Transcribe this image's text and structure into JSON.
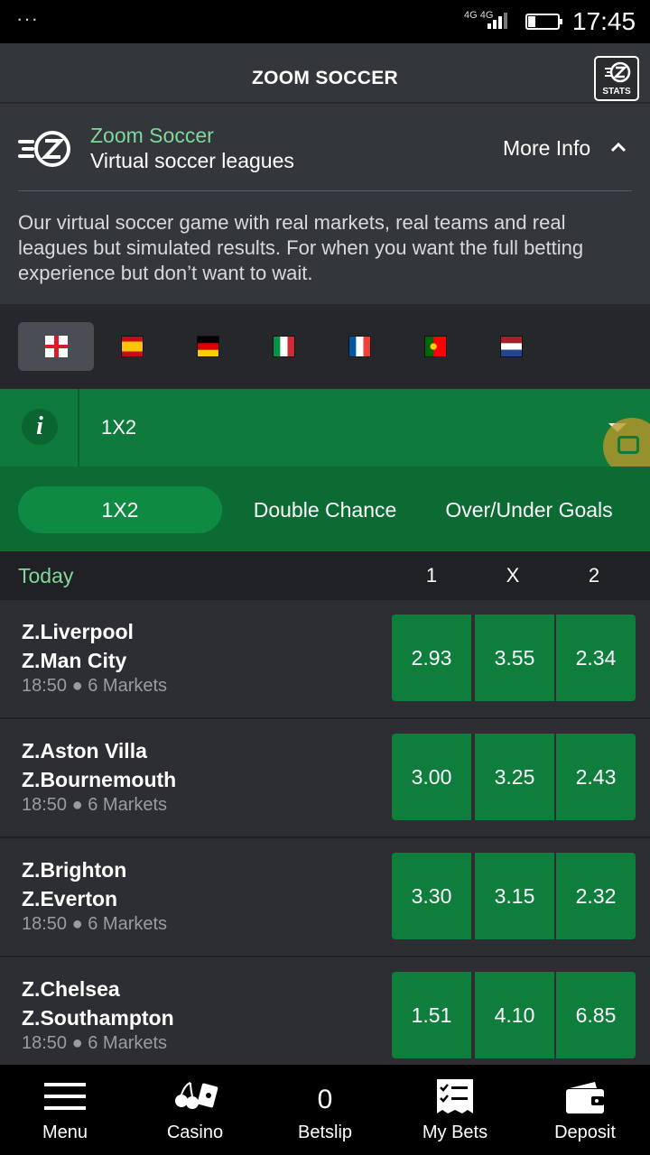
{
  "status_bar": {
    "dots": "···",
    "network": "4G 4G",
    "sim": "1",
    "time": "17:45"
  },
  "header": {
    "title": "ZOOM SOCCER",
    "stats_label": "STATS"
  },
  "info": {
    "name": "Zoom Soccer",
    "subtitle": "Virtual soccer leagues",
    "more_info": "More Info",
    "description": "Our virtual soccer game with real markets, real teams and real leagues but simulated results. For when you want the full betting experience but don’t want to wait."
  },
  "leagues": [
    {
      "country": "England",
      "active": true
    },
    {
      "country": "Spain",
      "active": false
    },
    {
      "country": "Germany",
      "active": false
    },
    {
      "country": "Italy",
      "active": false
    },
    {
      "country": "France",
      "active": false
    },
    {
      "country": "Portugal",
      "active": false
    },
    {
      "country": "Netherlands",
      "active": false
    }
  ],
  "market": {
    "info_glyph": "i",
    "selected": "1X2"
  },
  "market_tabs": [
    "1X2",
    "Double Chance",
    "Over/Under Goals"
  ],
  "columns": {
    "day": "Today",
    "c1": "1",
    "cx": "X",
    "c2": "2"
  },
  "events": [
    {
      "home": "Z.Liverpool",
      "away": "Z.Man City",
      "meta": "18:50 ● 6 Markets",
      "odds": [
        "2.93",
        "3.55",
        "2.34"
      ]
    },
    {
      "home": "Z.Aston Villa",
      "away": "Z.Bournemouth",
      "meta": "18:50 ● 6 Markets",
      "odds": [
        "3.00",
        "3.25",
        "2.43"
      ]
    },
    {
      "home": "Z.Brighton",
      "away": "Z.Everton",
      "meta": "18:50 ● 6 Markets",
      "odds": [
        "3.30",
        "3.15",
        "2.32"
      ]
    },
    {
      "home": "Z.Chelsea",
      "away": "Z.Southampton",
      "meta": "18:50 ● 6 Markets",
      "odds": [
        "1.51",
        "4.10",
        "6.85"
      ]
    }
  ],
  "bottom_nav": {
    "menu": "Menu",
    "casino": "Casino",
    "betslip_count": "0",
    "betslip": "Betslip",
    "mybets": "My Bets",
    "deposit": "Deposit"
  },
  "colors": {
    "accent_green": "#0f7d3c",
    "light_green_text": "#7fd99a",
    "panel": "#33363b"
  }
}
